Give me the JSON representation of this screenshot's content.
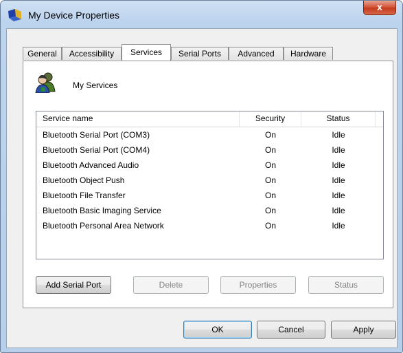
{
  "window": {
    "title": "My Device Properties",
    "close_glyph": "x"
  },
  "tabs": [
    {
      "label": "General"
    },
    {
      "label": "Accessibility"
    },
    {
      "label": "Services",
      "active": true
    },
    {
      "label": "Serial Ports"
    },
    {
      "label": "Advanced"
    },
    {
      "label": "Hardware"
    }
  ],
  "panel": {
    "heading": "My Services",
    "icon": "users-icon"
  },
  "services": {
    "columns": [
      "Service name",
      "Security",
      "Status"
    ],
    "rows": [
      [
        "Bluetooth Serial Port (COM3)",
        "On",
        "Idle"
      ],
      [
        "Bluetooth Serial Port (COM4)",
        "On",
        "Idle"
      ],
      [
        "Bluetooth Advanced Audio",
        "On",
        "Idle"
      ],
      [
        "Bluetooth Object Push",
        "On",
        "Idle"
      ],
      [
        "Bluetooth File Transfer",
        "On",
        "Idle"
      ],
      [
        "Bluetooth Basic Imaging Service",
        "On",
        "Idle"
      ],
      [
        "Bluetooth Personal Area Network",
        "On",
        "Idle"
      ]
    ]
  },
  "panel_buttons": {
    "add": "Add Serial Port",
    "delete": "Delete",
    "properties": "Properties",
    "status": "Status"
  },
  "dialog_buttons": {
    "ok": "OK",
    "cancel": "Cancel",
    "apply": "Apply"
  }
}
